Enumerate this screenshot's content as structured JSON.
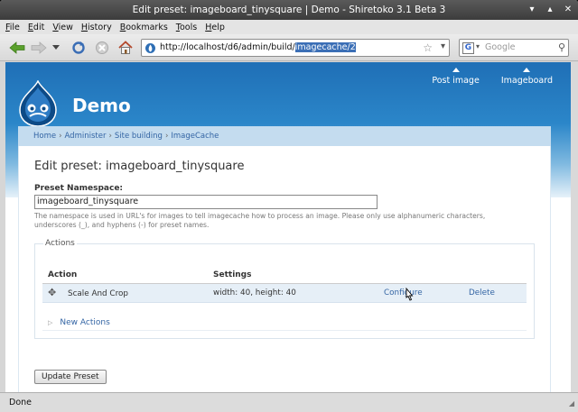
{
  "window": {
    "title": "Edit preset: imageboard_tinysquare | Demo - Shiretoko 3.1 Beta 3"
  },
  "menu": [
    {
      "u": "F",
      "rest": "ile"
    },
    {
      "u": "E",
      "rest": "dit"
    },
    {
      "u": "V",
      "rest": "iew"
    },
    {
      "u": "H",
      "rest": "istory"
    },
    {
      "u": "B",
      "rest": "ookmarks"
    },
    {
      "u": "T",
      "rest": "ools"
    },
    {
      "u": "H",
      "rest": "elp"
    }
  ],
  "nav": {
    "url_prefix": "http://localhost/d6/admin/build/",
    "url_selected": "imagecache/2",
    "search_placeholder": "Google",
    "search_engine_letter": "G"
  },
  "site": {
    "name": "Demo",
    "primary_links": [
      "Post image",
      "Imageboard"
    ]
  },
  "breadcrumb": [
    "Home",
    "Administer",
    "Site building",
    "ImageCache"
  ],
  "breadcrumb_separator": "›",
  "page": {
    "title": "Edit preset: imageboard_tinysquare",
    "namespace_label": "Preset Namespace:",
    "namespace_value": "imageboard_tinysquare",
    "namespace_desc": "The namespace is used in URL's for images to tell imagecache how to process an image. Please only use alphanumeric characters, underscores (_), and hyphens (-) for preset names.",
    "actions_legend": "Actions",
    "table_headers": [
      "Action",
      "Settings"
    ],
    "action_rows": [
      {
        "action": "Scale And Crop",
        "settings": "width: 40, height: 40",
        "configure": "Configure",
        "delete": "Delete"
      }
    ],
    "new_actions": "New Actions",
    "update_button": "Update Preset"
  },
  "status": {
    "text": "Done"
  },
  "colors": {
    "header_blue": "#2b86c9",
    "link": "#3465a4",
    "row_bg": "#e6eff7"
  },
  "icons": [
    "back-icon",
    "forward-icon",
    "dropdown-icon",
    "reload-icon",
    "stop-icon",
    "home-icon",
    "site-icon",
    "bookmark-star-icon",
    "search-icon",
    "drupal-logo-icon",
    "drag-handle-icon"
  ]
}
